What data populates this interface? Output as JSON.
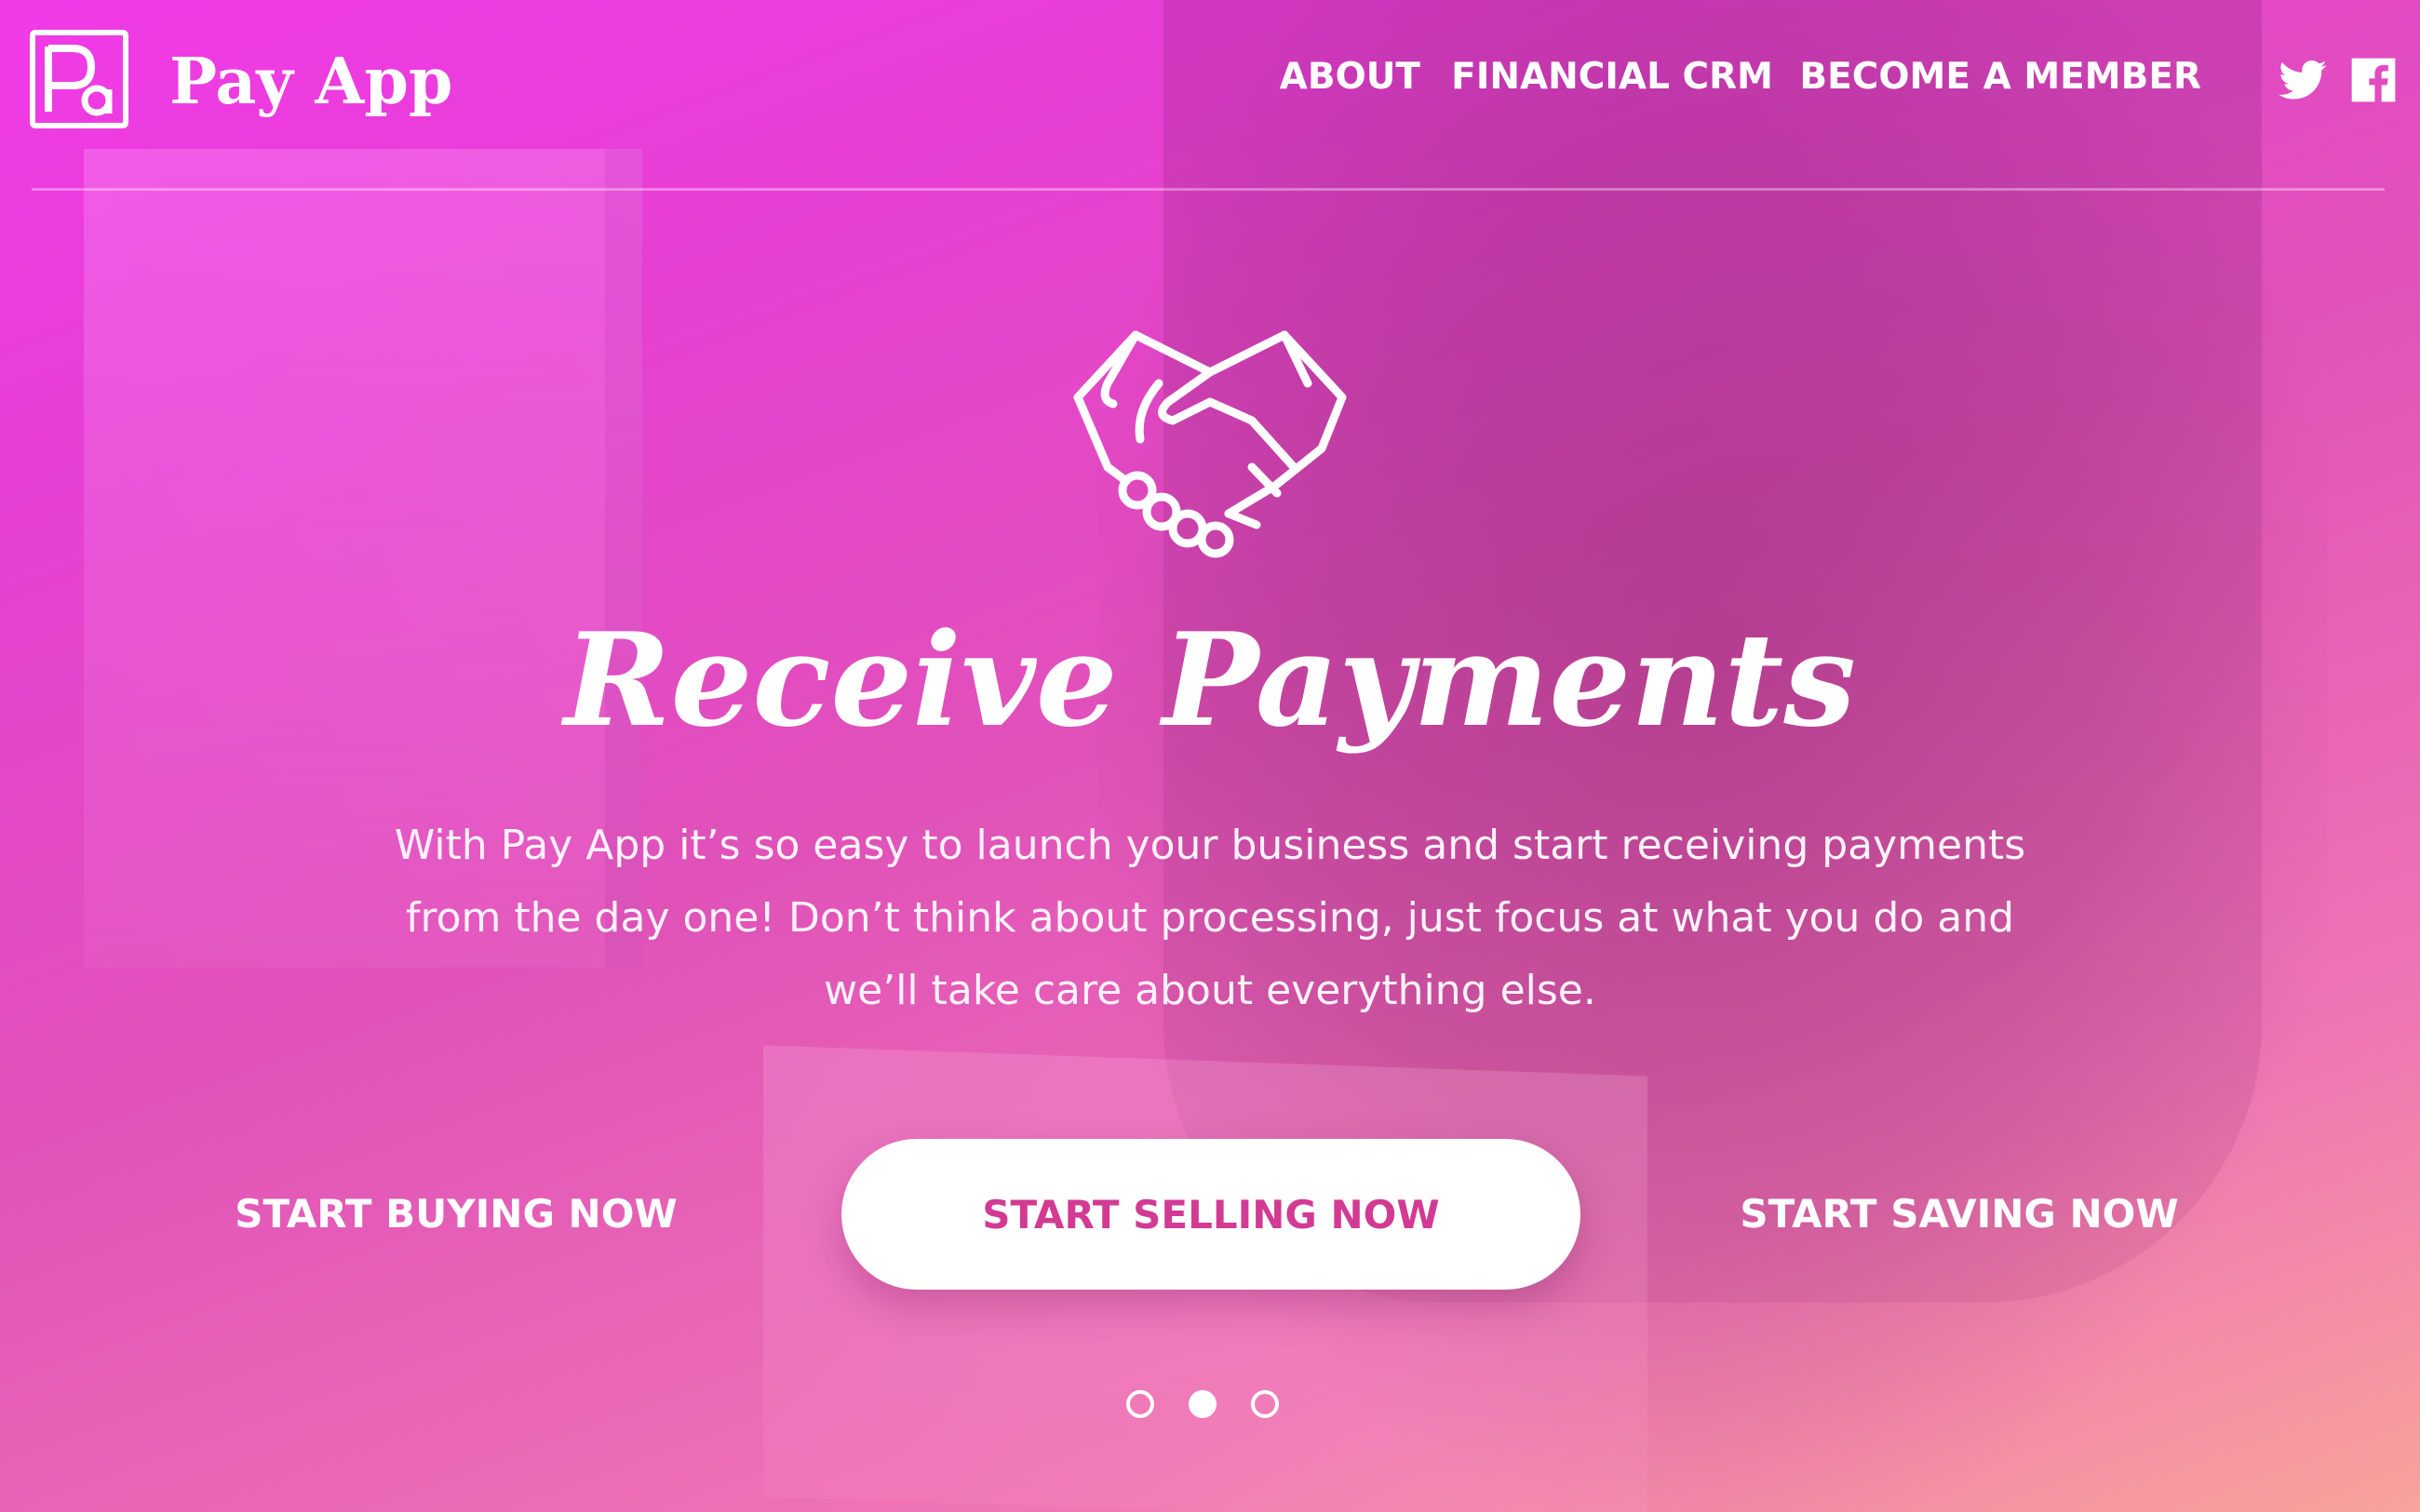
{
  "brand": {
    "name": "Pay App"
  },
  "nav": {
    "items": [
      {
        "label": "ABOUT"
      },
      {
        "label": "FINANCIAL CRM"
      },
      {
        "label": "BECOME A MEMBER"
      }
    ],
    "social": [
      {
        "icon": "twitter-icon"
      },
      {
        "icon": "facebook-icon"
      }
    ]
  },
  "hero": {
    "icon": "handshake-icon",
    "title": "Receive Payments",
    "text": "With Pay App it’s so easy to launch your business and start receiving payments from the day one! Don’t think about processing, just focus at what you do and we’ll take care about everything else."
  },
  "cta": {
    "buy": "START BUYING NOW",
    "sell": "START SELLING NOW",
    "save": "START SAVING NOW"
  },
  "carousel": {
    "slides": 3,
    "active_index": 2
  },
  "colors": {
    "gradient_start": "#f03ae8",
    "gradient_end": "#f7a39a",
    "primary_button_text": "#d23a93",
    "text": "#ffffff"
  }
}
